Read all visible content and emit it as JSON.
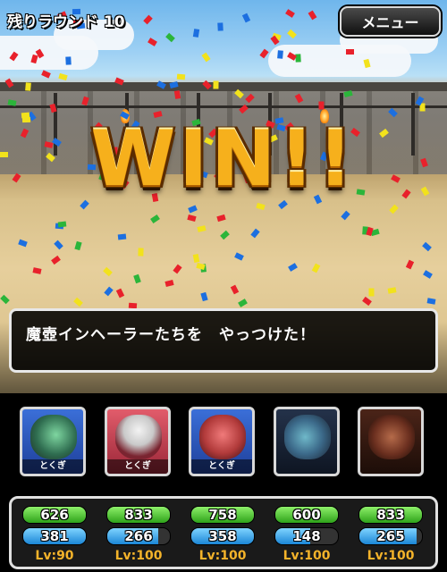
{
  "header": {
    "remaining_rounds": "残りラウンド 10",
    "menu_label": "メニュー"
  },
  "banner": {
    "text": "WIN!!"
  },
  "message": {
    "text": "魔壺インヘーラーたちを　やっつけた！"
  },
  "party": [
    {
      "tag": "とくぎ",
      "hp": "626",
      "hp_ratio": 1.0,
      "mp": "381",
      "mp_ratio": 1.0,
      "level": "Lv:90",
      "color": "blue"
    },
    {
      "tag": "とくぎ",
      "hp": "833",
      "hp_ratio": 1.0,
      "mp": "266",
      "mp_ratio": 0.82,
      "level": "Lv:100",
      "color": "red"
    },
    {
      "tag": "とくぎ",
      "hp": "758",
      "hp_ratio": 1.0,
      "mp": "358",
      "mp_ratio": 1.0,
      "level": "Lv:100",
      "color": "blue"
    },
    {
      "tag": "",
      "hp": "600",
      "hp_ratio": 1.0,
      "mp": "148",
      "mp_ratio": 0.55,
      "level": "Lv:100",
      "color": "dark"
    },
    {
      "tag": "",
      "hp": "833",
      "hp_ratio": 1.0,
      "mp": "265",
      "mp_ratio": 0.92,
      "level": "Lv:100",
      "color": "darkred"
    }
  ],
  "colors": {
    "win_gold": "#f6b01c",
    "level_text": "#f4b32a",
    "hp_bar": "#2ea31a",
    "mp_bar": "#1b86d6"
  }
}
